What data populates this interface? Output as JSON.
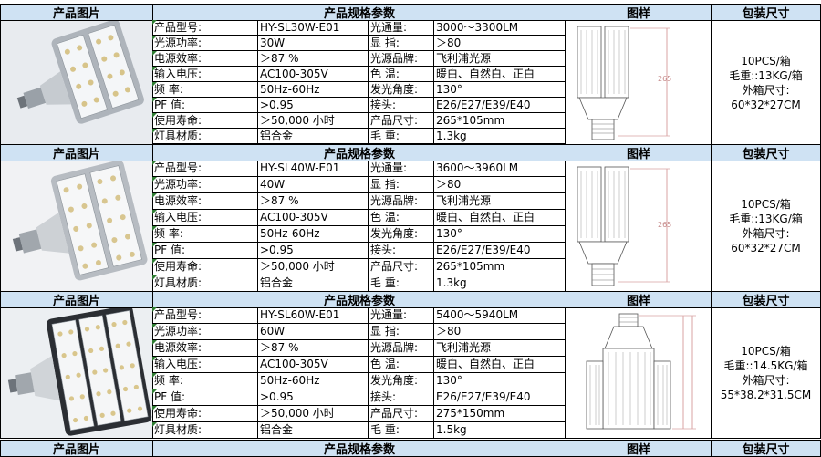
{
  "header": {
    "photo": "产品图片",
    "spec": "产品规格参数",
    "drawing": "图样",
    "pack": "包装尺寸"
  },
  "products": [
    {
      "rows": [
        [
          "产品型号:",
          "HY-SL30W-E01",
          "光通量:",
          "3000～3300LM"
        ],
        [
          "光源功率:",
          "30W",
          "显    指:",
          "＞80"
        ],
        [
          "电源效率:",
          "＞87 %",
          "光源品牌:",
          "飞利浦光源"
        ],
        [
          "输入电压:",
          "AC100-305V",
          "色    温:",
          "暖白、自然白、正白"
        ],
        [
          "频      率:",
          "50Hz-60Hz",
          "发光角度:",
          "130°"
        ],
        [
          "PF 值:",
          ">0.95",
          "接头:",
          "E26/E27/E39/E40"
        ],
        [
          "使用寿命:",
          "＞50,000 小时",
          "产品尺寸:",
          "265*105mm"
        ],
        [
          "灯具材质:",
          "铝合金",
          "毛      重:",
          "1.3kg"
        ]
      ],
      "pack": [
        "10PCS/箱",
        "毛重::13KG/箱",
        "外箱尺寸:",
        "60*32*27CM"
      ],
      "dim": "265"
    },
    {
      "rows": [
        [
          "产品型号:",
          "HY-SL40W-E01",
          "光通量:",
          "3600～3960LM"
        ],
        [
          "光源功率:",
          "40W",
          "显    指:",
          "＞80"
        ],
        [
          "电源效率:",
          "＞87 %",
          "光源品牌:",
          "飞利浦光源"
        ],
        [
          "输入电压:",
          "AC100-305V",
          "色    温:",
          "暖白、自然白、正白"
        ],
        [
          "频      率:",
          "50Hz-60Hz",
          "发光角度:",
          "130°"
        ],
        [
          "PF 值:",
          ">0.95",
          "接头:",
          "E26/E27/E39/E40"
        ],
        [
          "使用寿命:",
          "＞50,000 小时",
          "产品尺寸:",
          "265*105mm"
        ],
        [
          "灯具材质:",
          "铝合金",
          "毛      重:",
          "1.3kg"
        ]
      ],
      "pack": [
        "10PCS/箱",
        "毛重::13KG/箱",
        "外箱尺寸:",
        "60*32*27CM"
      ],
      "dim": "265"
    },
    {
      "rows": [
        [
          "产品型号:",
          "HY-SL60W-E01",
          "光通量:",
          "5400～5940LM"
        ],
        [
          "光源功率:",
          "60W",
          "显    指:",
          "＞80"
        ],
        [
          "电源效率:",
          "＞87 %",
          "光源品牌:",
          "飞利浦光源"
        ],
        [
          "输入电压:",
          "AC100-305V",
          "色    温:",
          "暖白、自然白、正白"
        ],
        [
          "频      率:",
          "50Hz-60Hz",
          "发光角度:",
          "130°"
        ],
        [
          "PF 值:",
          ">0.95",
          "接头:",
          "E26/E27/E39/E40"
        ],
        [
          "使用寿命:",
          "＞50,000 小时",
          "产品尺寸:",
          "275*150mm"
        ],
        [
          "灯具材质:",
          "铝合金",
          "毛      重:",
          "1.5kg"
        ]
      ],
      "pack": [
        "10PCS/箱",
        "毛重::14.5KG/箱",
        "外箱尺寸:",
        "55*38.2*31.5CM"
      ],
      "dim": ""
    }
  ]
}
